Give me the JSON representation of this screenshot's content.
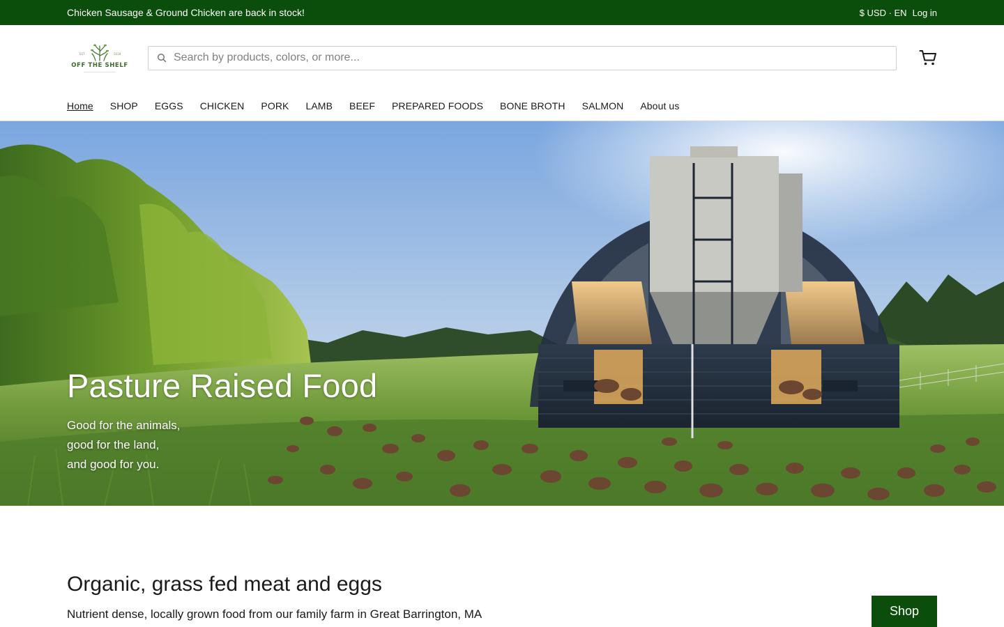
{
  "announcement": {
    "message": "Chicken Sausage & Ground Chicken are back in stock!",
    "currency_language": "$ USD · EN",
    "login_label": "Log in"
  },
  "header": {
    "logo_text": "OFF THE SHELF",
    "logo_icon": "sprout-icon",
    "search_placeholder": "Search by products, colors, or more...",
    "search_value": "",
    "cart_icon": "cart-icon"
  },
  "nav": {
    "items": [
      {
        "label": "Home",
        "active": true
      },
      {
        "label": "SHOP"
      },
      {
        "label": "EGGS"
      },
      {
        "label": "CHICKEN"
      },
      {
        "label": "PORK"
      },
      {
        "label": "LAMB"
      },
      {
        "label": "BEEF"
      },
      {
        "label": "PREPARED FOODS"
      },
      {
        "label": "BONE BROTH"
      },
      {
        "label": "SALMON"
      },
      {
        "label": "About us"
      }
    ]
  },
  "hero": {
    "title": "Pasture Raised Food",
    "lines": [
      "Good for the animals,",
      "good for the land,",
      "and good for you."
    ]
  },
  "intro": {
    "heading": "Organic, grass fed meat and eggs",
    "subheading": "Nutrient dense, locally grown food from our family farm in Great Barrington, MA",
    "shop_label": "Shop"
  },
  "colors": {
    "brand_green": "#0b4d0b",
    "text": "#1a1a1a"
  }
}
